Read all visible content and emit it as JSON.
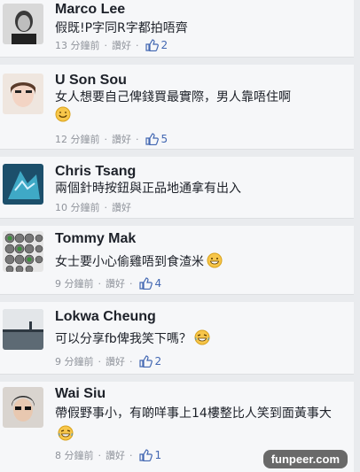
{
  "comments": [
    {
      "name": "Marco Lee",
      "text": "假既!P字同R字都拍唔齊",
      "time": "13 分鐘前",
      "like": "讚好",
      "likes": "2"
    },
    {
      "name": "U Son Sou",
      "text": "女人想要自己俾錢買最實際，男人靠唔住啊",
      "emoji": "smile-emoji",
      "time": "12 分鐘前",
      "like": "讚好",
      "likes": "5"
    },
    {
      "name": "Chris Tsang",
      "text": "兩個針時按鈕與正品地通拿有出入",
      "time": "10 分鐘前",
      "like": "讚好",
      "likes": ""
    },
    {
      "name": "Tommy Mak",
      "text": "女士要小心偷雞唔到食渣米",
      "emoji": "grin-emoji",
      "time": "9 分鐘前",
      "like": "讚好",
      "likes": "4"
    },
    {
      "name": "Lokwa Cheung",
      "text": "可以分享fb俾我笑下嗎？",
      "emoji": "laugh-cry-emoji",
      "time": "9 分鐘前",
      "like": "讚好",
      "likes": "2"
    },
    {
      "name": "Wai Siu",
      "text": "帶假野事小，有啲咩事上14樓整比人笑到面黃事大",
      "emoji": "laugh-cry-emoji",
      "time": "8 分鐘前",
      "like": "讚好",
      "likes": "1"
    }
  ],
  "meta_separator": "·",
  "watermark": "funpeer.com",
  "colors": {
    "background": "#e9ebee",
    "card": "#f6f7f9",
    "name": "#1d2129",
    "meta": "#90949c",
    "like_icon": "#4267b2"
  }
}
